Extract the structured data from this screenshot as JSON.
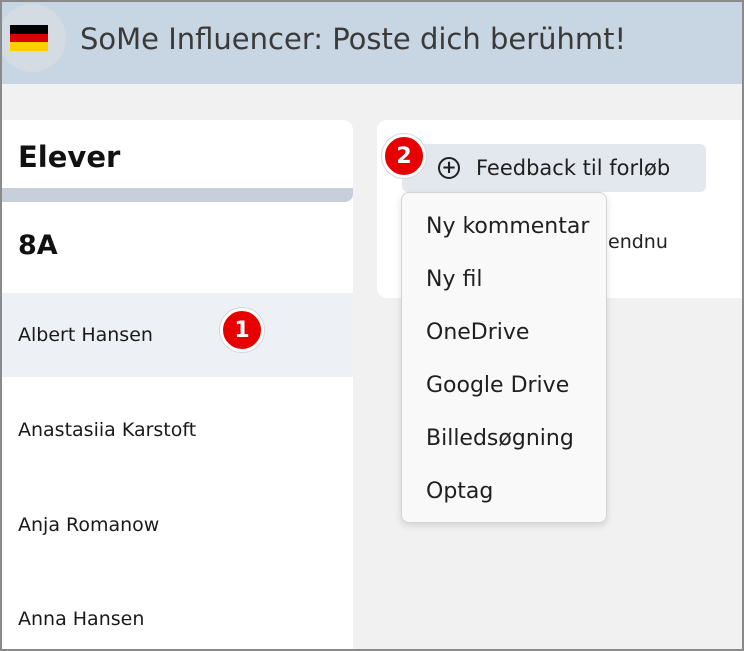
{
  "header": {
    "title": "SoMe Influencer: Poste dich berühmt!",
    "flag_icon": "germany-flag-icon",
    "flag_colors": [
      "#000000",
      "#dd0000",
      "#ffce00"
    ]
  },
  "left_panel": {
    "title": "Elever",
    "class_label": "8A",
    "students": [
      {
        "name": "Albert Hansen",
        "selected": true
      },
      {
        "name": "Anastasiia Karstoft",
        "selected": false
      },
      {
        "name": "Anja Romanow",
        "selected": false
      },
      {
        "name": "Anna Hansen",
        "selected": false
      }
    ]
  },
  "right_panel": {
    "feedback_button_label": "Feedback til forløb",
    "feedback_icon": "plus-circle-icon",
    "partial_text": "endnu"
  },
  "dropdown": {
    "items": [
      "Ny kommentar",
      "Ny fil",
      "OneDrive",
      "Google Drive",
      "Billedsøgning",
      "Optag"
    ]
  },
  "badges": {
    "step1": "1",
    "step2": "2",
    "color": "#e60000"
  }
}
